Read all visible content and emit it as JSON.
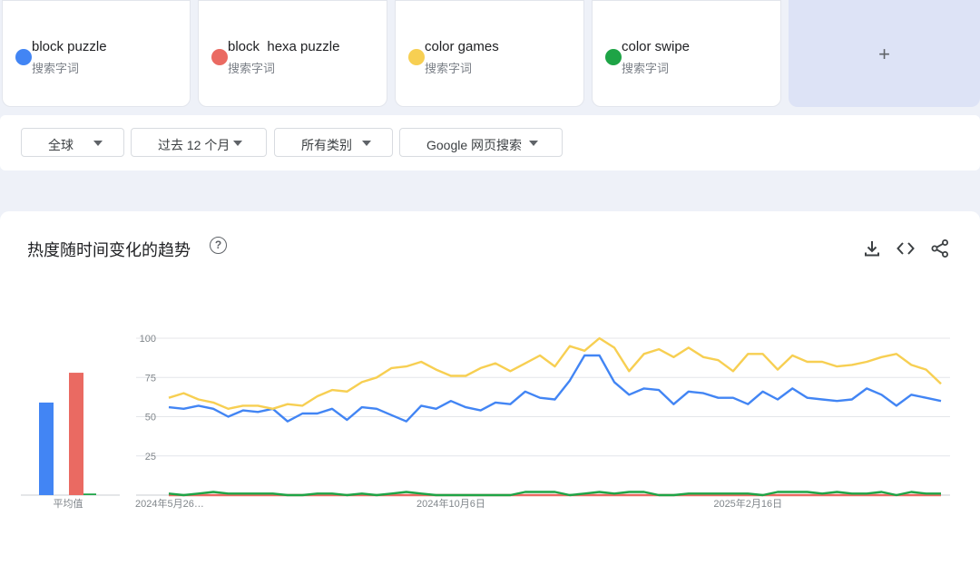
{
  "terms": [
    {
      "name": "block puzzle",
      "sub": "搜索字词",
      "color": "#4285f4"
    },
    {
      "name": "block  hexa puzzle",
      "sub": "搜索字词",
      "color": "#ea6a62"
    },
    {
      "name": "color games",
      "sub": "搜索字词",
      "color": "#f7cf52"
    },
    {
      "name": "color swipe",
      "sub": "搜索字词",
      "color": "#1ea446"
    }
  ],
  "add_label": "+",
  "filters": {
    "region": "全球",
    "period": "过去 12 个月",
    "category": "所有类别",
    "search_type": "Google 网页搜索"
  },
  "card": {
    "title": "热度随时间变化的趋势",
    "help_glyph": "?",
    "icons": [
      "download-icon",
      "embed-code-icon",
      "share-icon"
    ]
  },
  "chart_data": {
    "type": "line",
    "y_ticks": [
      25,
      50,
      75,
      100
    ],
    "ylim": [
      0,
      100
    ],
    "grid": true,
    "x_tick_labels": [
      {
        "label": "2024年5月26…",
        "index": 0
      },
      {
        "label": "2024年10月6日",
        "index": 19
      },
      {
        "label": "2025年2月16日",
        "index": 39
      }
    ],
    "average_label": "平均值",
    "averages": [
      59,
      78,
      0,
      1
    ],
    "series": [
      {
        "color": "#4285f4",
        "values": [
          56,
          55,
          57,
          55,
          50,
          54,
          53,
          55,
          47,
          52,
          52,
          55,
          48,
          56,
          55,
          51,
          47,
          57,
          55,
          60,
          56,
          54,
          59,
          58,
          66,
          62,
          61,
          73,
          89,
          89,
          72,
          64,
          68,
          67,
          58,
          66,
          65,
          62,
          62,
          58,
          66,
          61,
          68,
          62,
          61,
          60,
          61,
          68,
          64,
          57,
          64,
          62,
          60
        ]
      },
      {
        "color": "#ea6a62",
        "values": [
          0,
          0,
          0,
          0,
          0,
          0,
          0,
          0,
          0,
          0,
          0,
          0,
          0,
          0,
          0,
          0,
          0,
          0,
          0,
          0,
          0,
          0,
          0,
          0,
          0,
          0,
          0,
          0,
          0,
          0,
          0,
          0,
          0,
          0,
          0,
          0,
          0,
          0,
          0,
          0,
          0,
          0,
          0,
          0,
          0,
          0,
          0,
          0,
          0,
          0,
          0,
          0,
          0
        ]
      },
      {
        "color": "#f7cf52",
        "values": [
          62,
          65,
          61,
          59,
          55,
          57,
          57,
          55,
          58,
          57,
          63,
          67,
          66,
          72,
          75,
          81,
          82,
          85,
          80,
          76,
          76,
          81,
          84,
          79,
          84,
          89,
          82,
          95,
          92,
          100,
          94,
          79,
          90,
          93,
          88,
          94,
          88,
          86,
          79,
          90,
          90,
          80,
          89,
          85,
          85,
          82,
          83,
          85,
          88,
          90,
          83,
          80,
          71
        ]
      },
      {
        "color": "#1ea446",
        "values": [
          1,
          0,
          1,
          2,
          1,
          1,
          1,
          1,
          0,
          0,
          1,
          1,
          0,
          1,
          0,
          1,
          2,
          1,
          0,
          0,
          0,
          0,
          0,
          0,
          2,
          2,
          2,
          0,
          1,
          2,
          1,
          2,
          2,
          0,
          0,
          1,
          1,
          1,
          1,
          1,
          0,
          2,
          2,
          2,
          1,
          2,
          1,
          1,
          2,
          0,
          2,
          1,
          1
        ]
      }
    ]
  }
}
